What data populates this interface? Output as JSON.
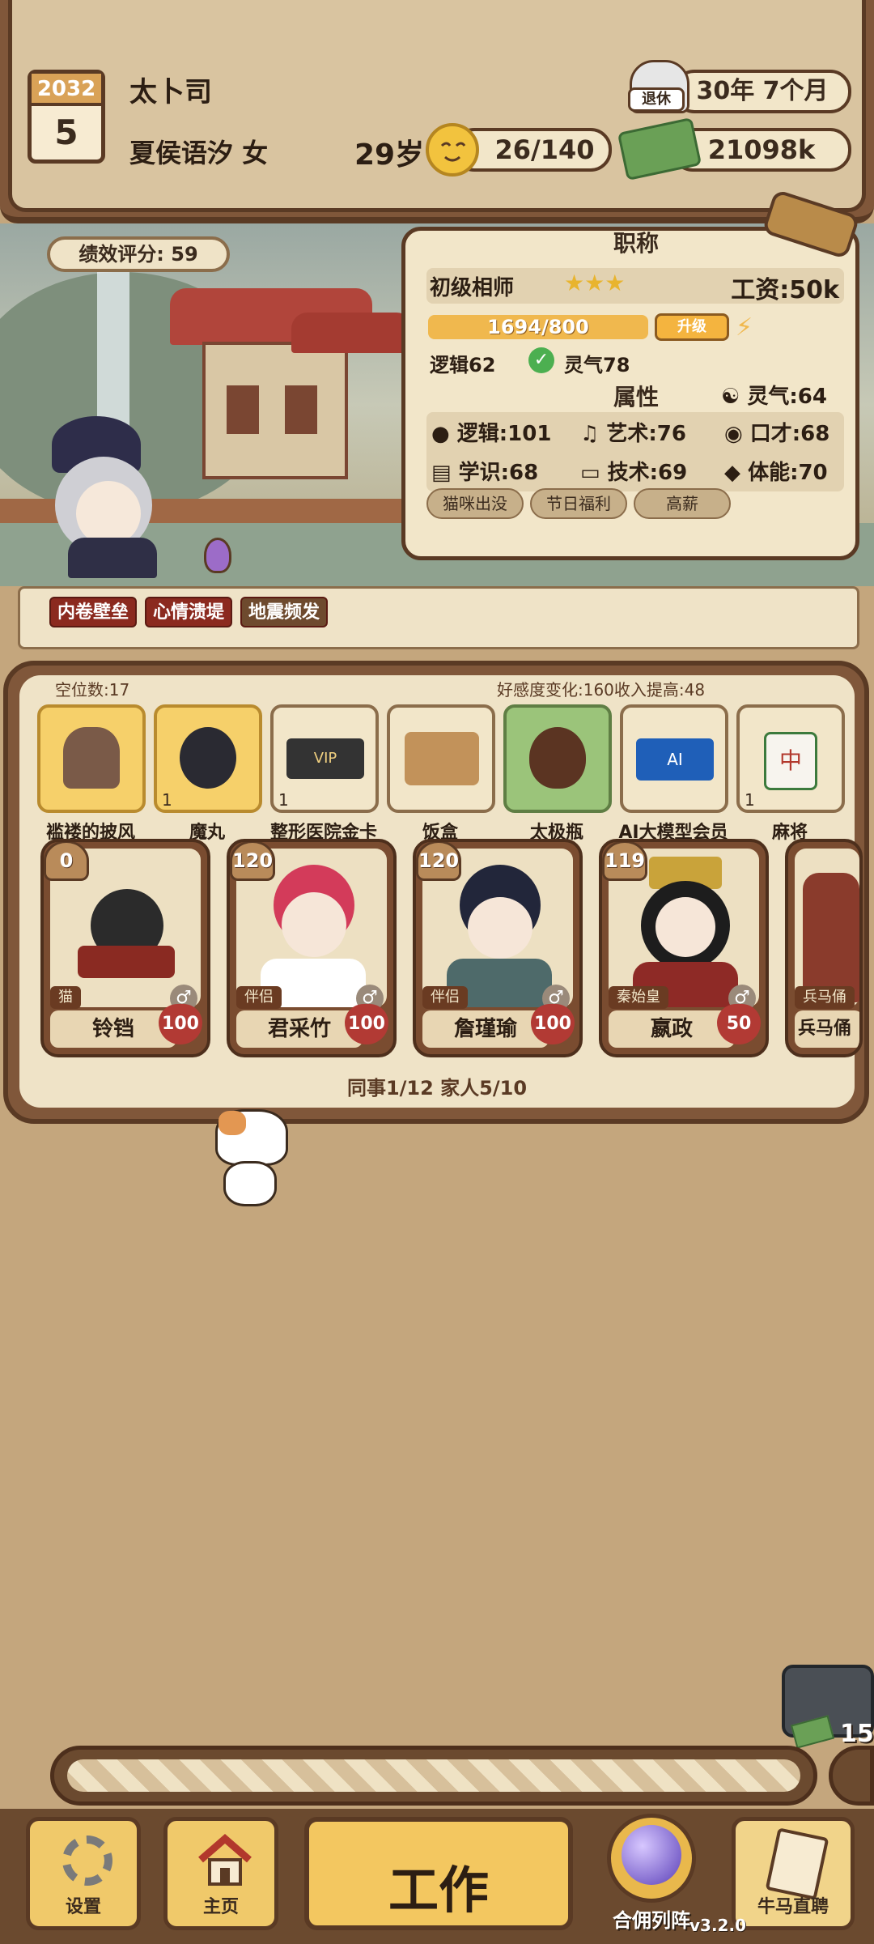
{
  "header": {
    "calendar_year": "2032",
    "calendar_month": "5",
    "title": "太卜司",
    "name_gender": "夏侯语汐 女",
    "age": "29岁",
    "mood": "26/140",
    "retire_label": "退休",
    "retire_time": "30年 7个月",
    "money": "21098k"
  },
  "scene": {
    "score_label": "绩效评分:",
    "score_value": "59"
  },
  "info": {
    "job_title_header": "职称",
    "job_title": "初级相师",
    "stars": "★★★",
    "salary": "工资:50k",
    "progress": "1694/800",
    "progress_fraction": 1.0,
    "upgrade_label": "升级",
    "logic_req": "逻辑62",
    "lingqi_req": "灵气78",
    "attr_header": "属性",
    "lingqi": "灵气:64",
    "attrs": [
      {
        "label": "逻辑:101",
        "icon": "brain-icon"
      },
      {
        "label": "艺术:76",
        "icon": "music-note-icon"
      },
      {
        "label": "口才:68",
        "icon": "lips-icon"
      },
      {
        "label": "学识:68",
        "icon": "book-icon"
      },
      {
        "label": "技术:69",
        "icon": "monitor-icon"
      },
      {
        "label": "体能:70",
        "icon": "shield-icon"
      }
    ],
    "tags": [
      "猫咪出没",
      "节日福利",
      "高薪"
    ]
  },
  "events": [
    "内卷壁垒",
    "心情溃堤",
    "地震频发"
  ],
  "inventory": {
    "slots_label": "空位数:17",
    "bonus_label": "好感度变化:160收入提高:48",
    "items": [
      {
        "name": "褴褛的披风",
        "count": "",
        "icon": "cloak-icon"
      },
      {
        "name": "魔丸",
        "count": "1",
        "icon": "magic-pill-icon"
      },
      {
        "name": "整形医院金卡",
        "count": "1",
        "icon": "vip-card-icon"
      },
      {
        "name": "饭盒",
        "count": "",
        "icon": "lunchbox-icon"
      },
      {
        "name": "太极瓶",
        "count": "",
        "icon": "gourd-icon"
      },
      {
        "name": "AI大模型会员",
        "count": "",
        "icon": "ai-card-icon"
      },
      {
        "name": "麻将",
        "count": "1",
        "icon": "mahjong-icon"
      }
    ],
    "members": [
      {
        "name": "铃铛",
        "role": "猫",
        "level": "0",
        "favor": "100"
      },
      {
        "name": "君采竹",
        "role": "伴侣",
        "level": "120",
        "favor": "100"
      },
      {
        "name": "詹瑾瑜",
        "role": "伴侣",
        "level": "120",
        "favor": "100"
      },
      {
        "name": "嬴政",
        "role": "秦始皇",
        "level": "119",
        "favor": "50"
      },
      {
        "name": "兵马俑战",
        "role": "兵马俑",
        "level": "",
        "favor": ""
      }
    ],
    "footer": "同事1/12 家人5/10"
  },
  "chest_count": "15",
  "bottom_nav": {
    "settings": "设置",
    "home": "主页",
    "work": "工作",
    "formation": "合佣列阵",
    "hire": "牛马直聘",
    "version": "v3.2.0"
  }
}
